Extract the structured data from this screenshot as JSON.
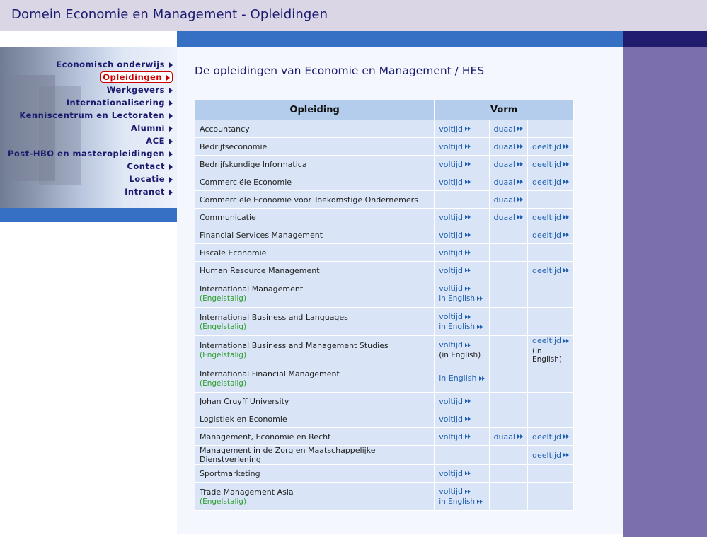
{
  "header": {
    "title": "Domein Economie en Management - Opleidingen"
  },
  "nav": [
    {
      "label": "Economisch onderwijs",
      "active": false
    },
    {
      "label": "Opleidingen",
      "active": true
    },
    {
      "label": "Werkgevers",
      "active": false
    },
    {
      "label": "Internationalisering",
      "active": false
    },
    {
      "label": "Kenniscentrum en Lectoraten",
      "active": false
    },
    {
      "label": "Alumni",
      "active": false
    },
    {
      "label": "ACE",
      "active": false
    },
    {
      "label": "Post-HBO en masteropleidingen",
      "active": false
    },
    {
      "label": "Contact",
      "active": false
    },
    {
      "label": "Locatie",
      "active": false
    },
    {
      "label": "Intranet",
      "active": false
    }
  ],
  "main": {
    "title": "De opleidingen van Economie en Management / HES",
    "table": {
      "headers": {
        "opleiding": "Opleiding",
        "vorm": "Vorm"
      },
      "rows": [
        {
          "name": "Accountancy",
          "c1": "voltijd",
          "c2": "duaal",
          "c3": ""
        },
        {
          "name": "Bedrijfseconomie",
          "c1": "voltijd",
          "c2": "duaal",
          "c3": "deeltijd"
        },
        {
          "name": "Bedrijfskundige Informatica",
          "c1": "voltijd",
          "c2": "duaal",
          "c3": "deeltijd"
        },
        {
          "name": "Commerciële Economie",
          "c1": "voltijd",
          "c2": "duaal",
          "c3": "deeltijd"
        },
        {
          "name": "Commerciële Economie voor Toekomstige Ondernemers",
          "c1": "",
          "c2": "duaal",
          "c3": ""
        },
        {
          "name": "Communicatie",
          "c1": "voltijd",
          "c2": "duaal",
          "c3": "deeltijd"
        },
        {
          "name": "Financial Services Management",
          "c1": "voltijd",
          "c2": "",
          "c3": "deeltijd"
        },
        {
          "name": "Fiscale Economie",
          "c1": "voltijd",
          "c2": "",
          "c3": ""
        },
        {
          "name": "Human Resource Management",
          "c1": "voltijd",
          "c2": "",
          "c3": "deeltijd"
        },
        {
          "name": "International Management",
          "note": "(Engelstalig)",
          "c1": "voltijd",
          "c1b": "in English",
          "c2": "",
          "c3": ""
        },
        {
          "name": "International Business and Languages",
          "note": "(Engelstalig)",
          "c1": "voltijd",
          "c1b": "in English",
          "c2": "",
          "c3": ""
        },
        {
          "name": "International Business and Management Studies",
          "note": "(Engelstalig)",
          "c1": "voltijd",
          "c1plain": "(in English)",
          "c2": "",
          "c3": "deeltijd",
          "c3plain": "(in English)"
        },
        {
          "name": "International Financial Management",
          "note": "(Engelstalig)",
          "c1": "in English",
          "c2": "",
          "c3": ""
        },
        {
          "name": "Johan Cruyff University",
          "c1": "voltijd",
          "c2": "",
          "c3": ""
        },
        {
          "name": "Logistiek en Economie",
          "c1": "voltijd",
          "c2": "",
          "c3": ""
        },
        {
          "name": "Management, Economie en Recht",
          "c1": "voltijd",
          "c2": "duaal",
          "c3": "deeltijd"
        },
        {
          "name": "Management in de Zorg en Maatschappelijke Dienstverlening",
          "c1": "",
          "c2": "",
          "c3": "deeltijd"
        },
        {
          "name": "Sportmarketing",
          "c1": "voltijd",
          "c2": "",
          "c3": ""
        },
        {
          "name": "Trade Management Asia",
          "note": "(Engelstalig)",
          "c1": "voltijd",
          "c1b": "in English",
          "c2": "",
          "c3": ""
        }
      ]
    }
  },
  "colors": {
    "header_bg": "#dad6e6",
    "bar_blue": "#3570c4",
    "right_purple": "#7b6fae",
    "link": "#1f5fb0",
    "active_nav": "#cc0000",
    "note_green": "#2f9e2f"
  },
  "icons": {
    "link_arrow": "double-chevron-right-icon",
    "nav_arrow": "triangle-right-icon"
  }
}
